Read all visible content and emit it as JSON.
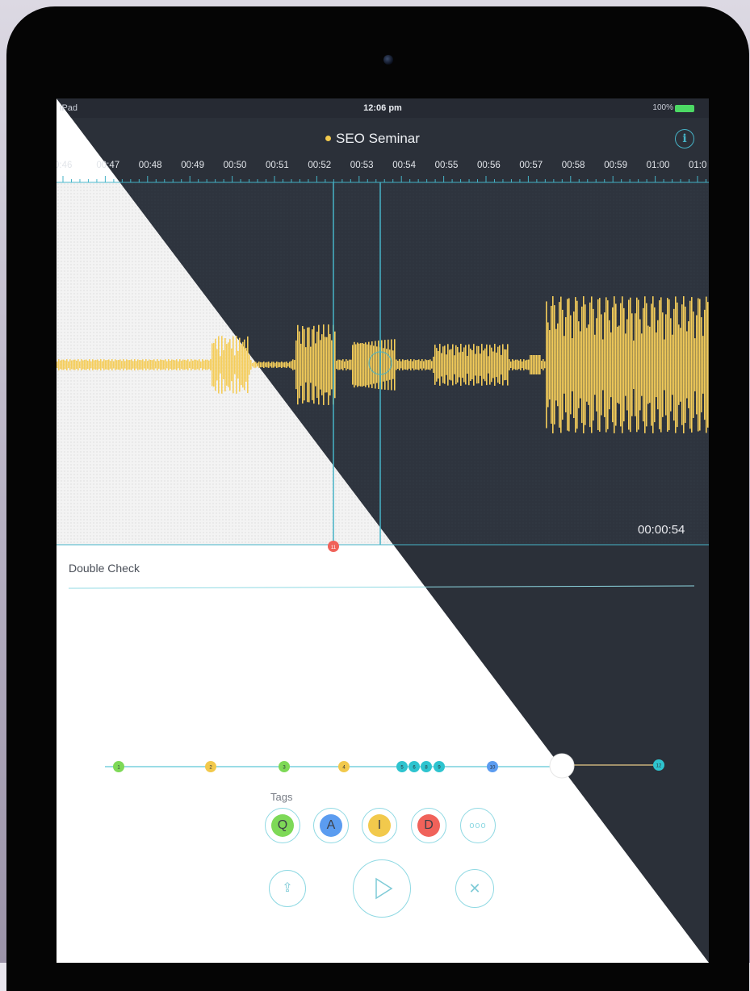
{
  "status": {
    "carrier": "iPad",
    "time": "12:06 pm",
    "battery": "100%"
  },
  "header": {
    "title": "SEO Seminar",
    "info_icon": "info-icon"
  },
  "timeline": {
    "ticks": [
      "0:46",
      "00:47",
      "00:48",
      "00:49",
      "00:50",
      "00:51",
      "00:52",
      "00:53",
      "00:54",
      "00:55",
      "00:56",
      "00:57",
      "00:58",
      "00:59",
      "01:00",
      "01:0"
    ]
  },
  "playhead": {
    "time": "00:00:54",
    "marker_label": "11"
  },
  "note": {
    "text": "Double Check"
  },
  "markers": [
    {
      "label": "1",
      "color": "#7ed957"
    },
    {
      "label": "2",
      "color": "#f2c94c"
    },
    {
      "label": "3",
      "color": "#7ed957"
    },
    {
      "label": "4",
      "color": "#f2c94c"
    },
    {
      "label": "5",
      "color": "#2ec4cf"
    },
    {
      "label": "6",
      "color": "#2ec4cf"
    },
    {
      "label": "8",
      "color": "#2ec4cf"
    },
    {
      "label": "9",
      "color": "#2ec4cf"
    },
    {
      "label": "10",
      "color": "#5b9cf0"
    },
    {
      "label": "12",
      "color": "#2ec4cf"
    }
  ],
  "tags": {
    "label": "Tags",
    "buttons": [
      {
        "label": "Q",
        "color": "#7ed957"
      },
      {
        "label": "A",
        "color": "#5b9cf0"
      },
      {
        "label": "I",
        "color": "#f2c94c"
      },
      {
        "label": "D",
        "color": "#f0625a"
      },
      {
        "label": "ooo",
        "color": "#ffffff"
      }
    ]
  },
  "controls": {
    "share_icon": "share-icon",
    "play_icon": "play-icon",
    "close_icon": "close-icon"
  },
  "colors": {
    "dark": "#2b3039",
    "accent": "#46b3c7",
    "wave": "#f5cd5a",
    "marker_red": "#f0625a"
  }
}
